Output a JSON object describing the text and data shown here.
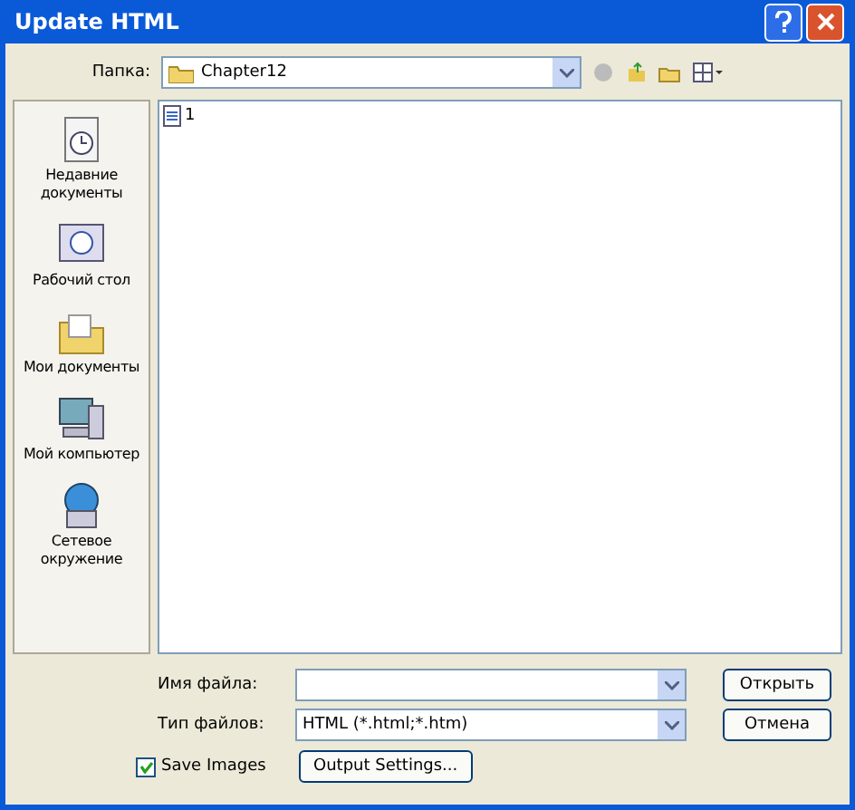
{
  "window": {
    "title": "Update HTML"
  },
  "folder": {
    "label": "Папка:",
    "value": "Chapter12"
  },
  "places": [
    {
      "label": "Недавние документы",
      "kind": "recent"
    },
    {
      "label": "Рабочий стол",
      "kind": "desktop"
    },
    {
      "label": "Мои документы",
      "kind": "documents"
    },
    {
      "label": "Мой компьютер",
      "kind": "computer"
    },
    {
      "label": "Сетевое окружение",
      "kind": "network"
    }
  ],
  "files": [
    {
      "name": "1"
    }
  ],
  "file_name": {
    "label": "Имя файла:"
  },
  "file_type": {
    "label": "Тип файлов:",
    "value": "HTML (*.html;*.htm)"
  },
  "buttons": {
    "open": "Открыть",
    "cancel": "Отмена",
    "output_settings": "Output Settings..."
  },
  "save_images": {
    "label": "Save Images",
    "checked": true
  }
}
